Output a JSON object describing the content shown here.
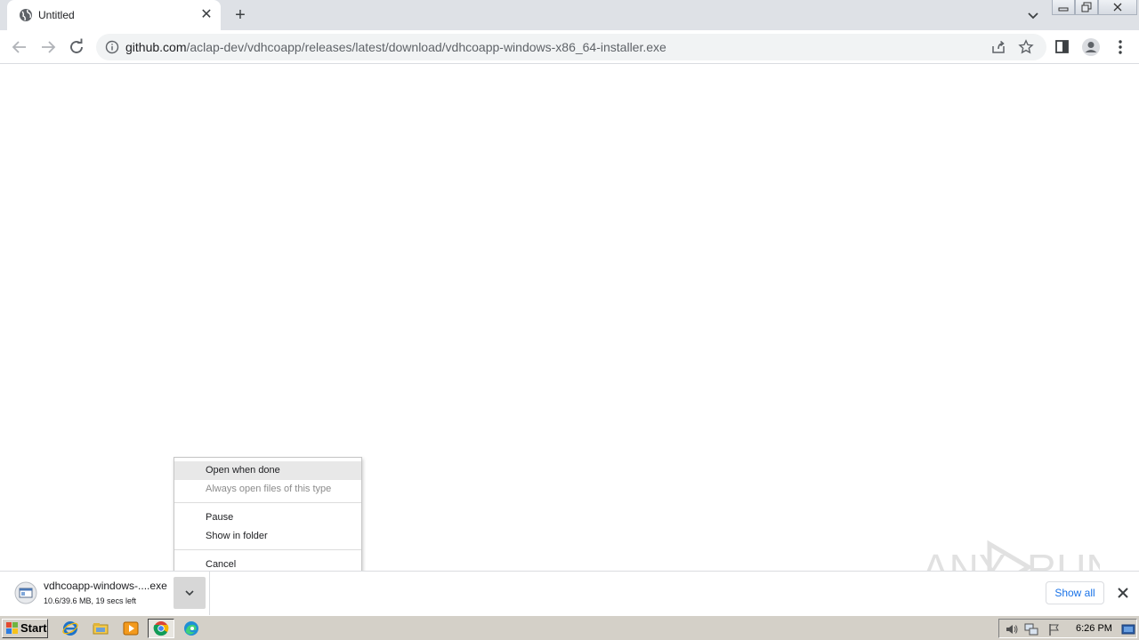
{
  "browser": {
    "tab": {
      "title": "Untitled",
      "close": "✕"
    },
    "new_tab": "+",
    "address": {
      "host": "github.com",
      "path": "/aclap-dev/vdhcoapp/releases/latest/download/vdhcoapp-windows-x86_64-installer.exe"
    }
  },
  "context_menu": {
    "items": [
      {
        "label": "Open when done",
        "highlighted": true,
        "disabled": false
      },
      {
        "label": "Always open files of this type",
        "highlighted": false,
        "disabled": true
      },
      {
        "label": "Pause",
        "highlighted": false,
        "disabled": false
      },
      {
        "label": "Show in folder",
        "highlighted": false,
        "disabled": false
      },
      {
        "label": "Cancel",
        "highlighted": false,
        "disabled": false
      }
    ]
  },
  "download_shelf": {
    "file_name": "vdhcoapp-windows-....exe",
    "status": "10.6/39.6 MB, 19 secs left",
    "show_all": "Show all"
  },
  "taskbar": {
    "start_label": "Start",
    "clock": "6:26 PM",
    "apps": [
      "internet-explorer-icon",
      "file-explorer-icon",
      "media-player-icon",
      "chrome-icon",
      "edge-icon"
    ]
  },
  "watermark": {
    "text": "ANY RUN"
  },
  "colors": {
    "tabstrip": "#dee1e6",
    "omnibox": "#f1f3f4",
    "link_blue": "#1a73e8",
    "taskbar": "#d4d0c8"
  }
}
